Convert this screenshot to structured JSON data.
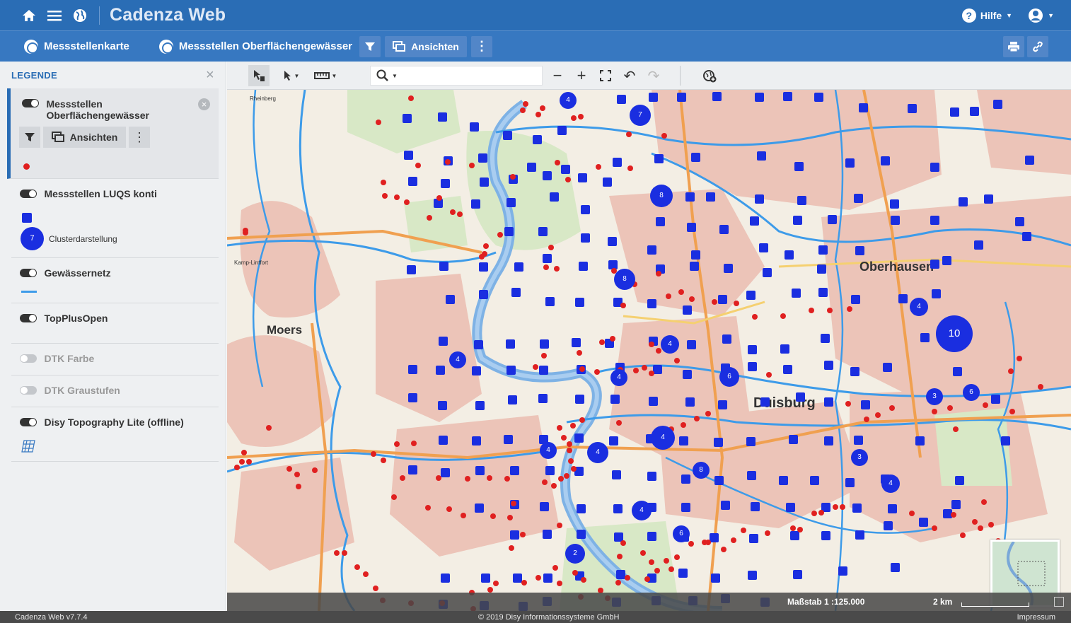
{
  "app": {
    "title": "Cadenza Web",
    "help_label": "Hilfe",
    "version": "Cadenza Web v7.7.4",
    "copyright": "© 2019 Disy Informationssysteme GmbH",
    "impressum": "Impressum",
    "accent": "#2a6db5"
  },
  "nav": {
    "map_label": "Messstellenkarte",
    "layer_label": "Messstellen Oberflächengewässer",
    "views_label": "Ansichten"
  },
  "legend": {
    "title": "LEGENDE",
    "layers": [
      {
        "name": "Messstellen Oberflächengewässer",
        "on": true,
        "views_label": "Ansichten"
      },
      {
        "name": "Messstellen LUQS konti",
        "on": true,
        "cluster_count": "7",
        "cluster_label": "Clusterdarstellung"
      },
      {
        "name": "Gewässernetz",
        "on": true
      },
      {
        "name": "TopPlusOpen",
        "on": true
      },
      {
        "name": "DTK Farbe",
        "on": false
      },
      {
        "name": "DTK Graustufen",
        "on": false
      },
      {
        "name": "Disy Topography Lite (offline)",
        "on": true
      }
    ]
  },
  "map": {
    "scale": "Maßstab 1 :125.000",
    "scale_dist": "2 km",
    "places": [
      {
        "name": "Moers"
      },
      {
        "name": "Oberhausen"
      },
      {
        "name": "Duisburg"
      },
      {
        "name": "Kamp-Lintfort"
      },
      {
        "name": "Rheinberg"
      }
    ],
    "clusters": [
      "4",
      "7",
      "8",
      "8",
      "4",
      "10",
      "4",
      "6",
      "4",
      "4",
      "4",
      "8",
      "3",
      "6",
      "4",
      "4",
      "3",
      "4",
      "4",
      "6",
      "2"
    ]
  }
}
